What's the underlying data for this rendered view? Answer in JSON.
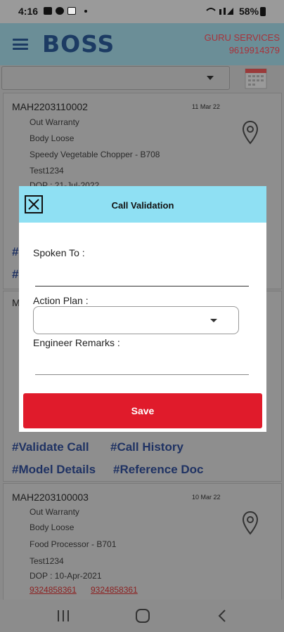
{
  "status_bar": {
    "time": "4:16",
    "battery": "58%"
  },
  "app_bar": {
    "logo": "BOSS",
    "company_name": "GURU SERVICES",
    "company_phone": "9619914379"
  },
  "cards": [
    {
      "id": "MAH2203110002",
      "date": "11 Mar 22",
      "lines": [
        "Out Warranty",
        "Body Loose",
        "Speedy Vegetable Chopper - B708",
        "Test1234",
        "DOP : 21-Jul-2022"
      ]
    },
    {
      "id": "M",
      "hash_left_partial": [
        "#",
        "#"
      ],
      "links": [
        "#Validate Call",
        "#Call History",
        "#Model Details",
        "#Reference Doc"
      ]
    },
    {
      "id": "MAH2203100003",
      "date": "10 Mar 22",
      "lines": [
        "Out Warranty",
        "Body Loose",
        "Food Processor - B701",
        "Test1234",
        "DOP : 10-Apr-2021"
      ],
      "phones": [
        "9324858361",
        "9324858361"
      ]
    }
  ],
  "modal": {
    "title": "Call Validation",
    "spoken_to_label": "Spoken To :",
    "spoken_to_value": "",
    "action_plan_label": "Action Plan :",
    "action_plan_value": "",
    "engineer_remarks_label": "Engineer Remarks :",
    "engineer_remarks_value": "",
    "save_label": "Save"
  },
  "icons": {
    "menu": "menu-icon",
    "calendar": "calendar-icon",
    "location": "location-pin-icon",
    "close": "close-icon",
    "nav_recents": "recents-icon",
    "nav_home": "home-icon",
    "nav_back": "back-icon"
  },
  "colors": {
    "header": "#8fe0f3",
    "save": "#e01b2b",
    "brand": "#1c3b63",
    "company": "#a8323a"
  }
}
